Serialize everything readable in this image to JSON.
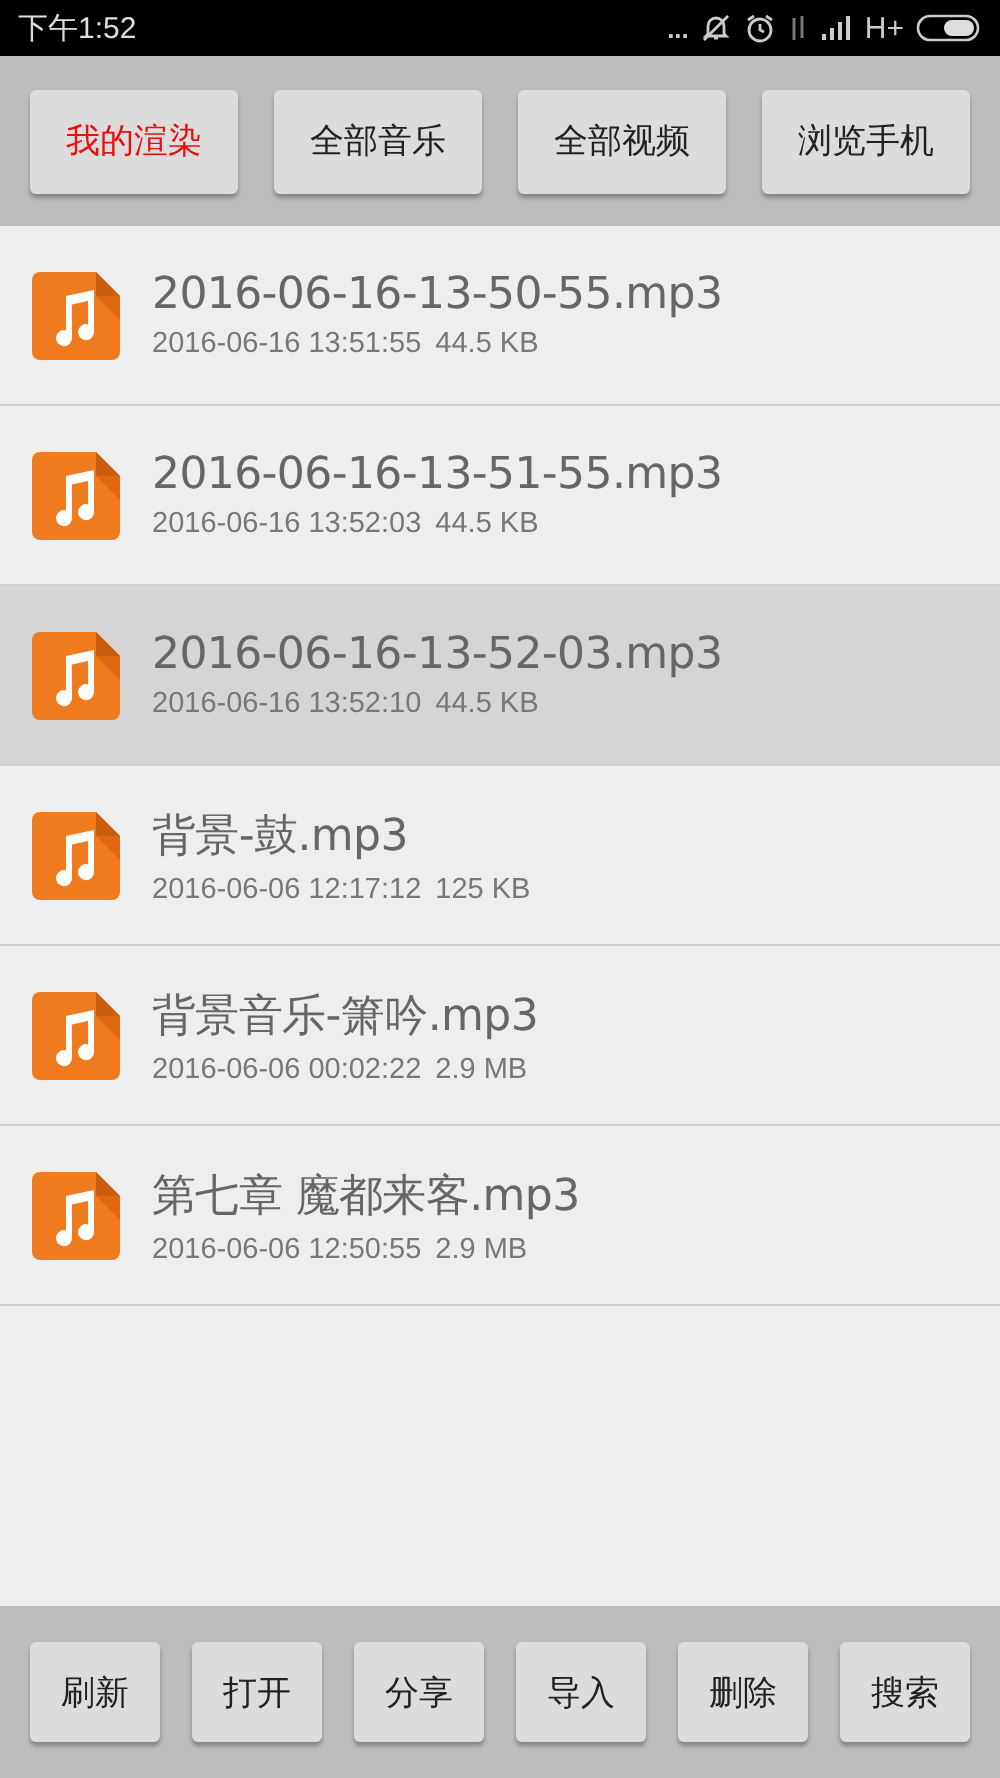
{
  "status_bar": {
    "time": "下午1:52",
    "more": "...",
    "network": "H+"
  },
  "tabs": [
    {
      "label": "我的渲染",
      "selected": true
    },
    {
      "label": "全部音乐",
      "selected": false
    },
    {
      "label": "全部视频",
      "selected": false
    },
    {
      "label": "浏览手机",
      "selected": false
    }
  ],
  "files": [
    {
      "name": "2016-06-16-13-50-55.mp3",
      "date": "2016-06-16 13:51:55",
      "size": "44.5 KB",
      "selected": false
    },
    {
      "name": "2016-06-16-13-51-55.mp3",
      "date": "2016-06-16 13:52:03",
      "size": "44.5 KB",
      "selected": false
    },
    {
      "name": "2016-06-16-13-52-03.mp3",
      "date": "2016-06-16 13:52:10",
      "size": "44.5 KB",
      "selected": true
    },
    {
      "name": "背景-鼓.mp3",
      "date": "2016-06-06 12:17:12",
      "size": "125 KB",
      "selected": false
    },
    {
      "name": "背景音乐-箫吟.mp3",
      "date": "2016-06-06 00:02:22",
      "size": "2.9 MB",
      "selected": false
    },
    {
      "name": "第七章 魔都来客.mp3",
      "date": "2016-06-06 12:50:55",
      "size": "2.9 MB",
      "selected": false
    }
  ],
  "actions": [
    "刷新",
    "打开",
    "分享",
    "导入",
    "删除",
    "搜索"
  ]
}
